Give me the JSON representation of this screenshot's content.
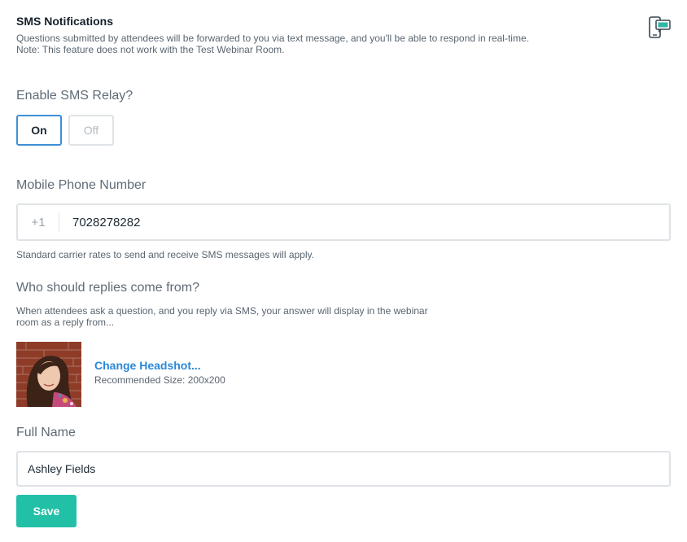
{
  "header": {
    "title": "SMS Notifications",
    "description_line1": "Questions submitted by attendees will be forwarded to you via text message, and you'll be able to respond in real-time.",
    "description_line2": "Note: This feature does not work with the Test Webinar Room.",
    "icon": "phone-sms-icon"
  },
  "relay": {
    "label": "Enable SMS Relay?",
    "on_label": "On",
    "off_label": "Off",
    "selected": "On"
  },
  "phone": {
    "label": "Mobile Phone Number",
    "country_code": "+1",
    "value": "7028278282",
    "hint": "Standard carrier rates to send and receive SMS messages will apply."
  },
  "replies": {
    "label": "Who should replies come from?",
    "description_line1": "When attendees ask a question, and you reply via SMS, your answer will display in the webinar",
    "description_line2": "room as a reply from...",
    "change_headshot": "Change Headshot...",
    "recommended_size": "Recommended Size: 200x200"
  },
  "full_name": {
    "label": "Full Name",
    "value": "Ashley Fields"
  },
  "actions": {
    "save_label": "Save"
  },
  "colors": {
    "accent_blue": "#3d8fd6",
    "link_blue": "#2b88d8",
    "save_green": "#23c0a8"
  }
}
